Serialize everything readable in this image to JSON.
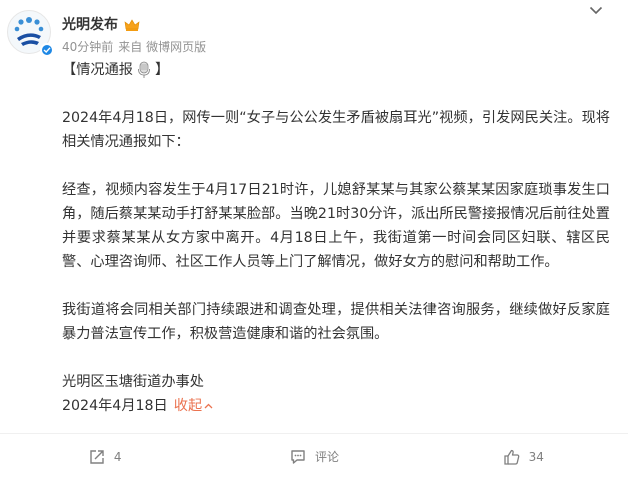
{
  "post": {
    "author": "光明发布",
    "meta": {
      "time": "40分钟前",
      "source": "来自 微博网页版"
    },
    "title_open": "【情况通报",
    "title_close": "】",
    "paragraphs": [
      "2024年4月18日，网传一则“女子与公公发生矛盾被扇耳光”视频，引发网民关注。现将相关情况通报如下：",
      "经查，视频内容发生于4月17日21时许，儿媳舒某某与其家公蔡某某因家庭琐事发生口角，随后蔡某某动手打舒某某脸部。当晚21时30分许，派出所民警接报情况后前往处置并要求蔡某某从女方家中离开。4月18日上午，我街道第一时间会同区妇联、辖区民警、心理咨询师、社区工作人员等上门了解情况，做好女方的慰问和帮助工作。",
      "我街道将会同相关部门持续跟进和调查处理，提供相关法律咨询服务，继续做好反家庭暴力普法宣传工作，积极营造健康和谐的社会氛围。"
    ],
    "signature": "光明区玉塘街道办事处",
    "date": "2024年4月18日",
    "collapse_label": "收起"
  },
  "actions": {
    "repost_count": "4",
    "comment_label": "评论",
    "like_count": "34"
  },
  "colors": {
    "accent": "#eb7350",
    "verified": "#1e88e5",
    "muted": "#939393"
  },
  "icons": [
    "avatar-logo",
    "verified-icon",
    "crown-badge-icon",
    "more-chevron-icon",
    "microphone-emoji-icon",
    "chevron-up-icon",
    "repost-icon",
    "comment-icon",
    "like-icon"
  ]
}
